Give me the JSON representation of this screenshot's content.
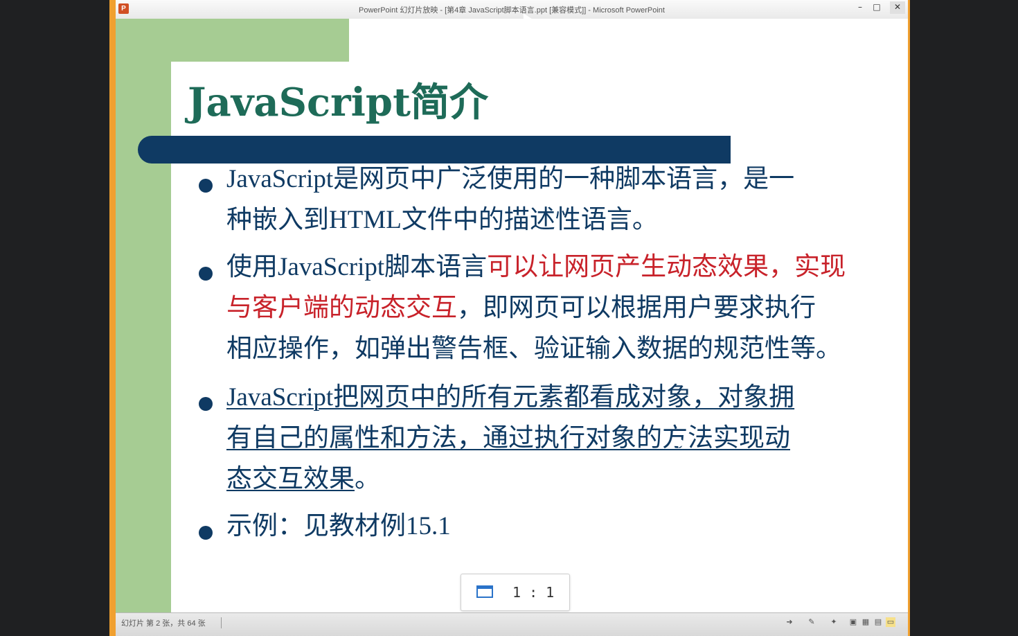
{
  "window": {
    "title": "PowerPoint 幻灯片放映 - [第4章 JavaScript脚本语言.ppt [兼容模式]] - Microsoft PowerPoint",
    "app_icon_letter": "P",
    "minimize": "–",
    "maximize": "□",
    "close": "✕"
  },
  "slide": {
    "title": "JavaScript简介",
    "bullets": [
      {
        "lines": [
          [
            {
              "text": "JavaScript是网页中广泛使用的一种脚本语言，是一",
              "style": "normal"
            }
          ],
          [
            {
              "text": "种嵌入到HTML文件中的描述性语言。",
              "style": "normal"
            }
          ]
        ]
      },
      {
        "lines": [
          [
            {
              "text": "使用JavaScript脚本语言",
              "style": "normal"
            },
            {
              "text": "可以让网页产生动态效果，实现",
              "style": "red"
            }
          ],
          [
            {
              "text": "与客户端的动态交互",
              "style": "red"
            },
            {
              "text": "，即网页可以根据用户要求执行",
              "style": "normal"
            }
          ],
          [
            {
              "text": "相应操作，如弹出警告框、验证输入数据的规范性等。",
              "style": "normal"
            }
          ]
        ]
      },
      {
        "lines": [
          [
            {
              "text": "JavaScript把网页中的所有元素都看成对象，对象拥",
              "style": "underline"
            }
          ],
          [
            {
              "text": "有自己的属性和方法，通过执行对象的方法实现动",
              "style": "underline"
            }
          ],
          [
            {
              "text": "态交互效果",
              "style": "underline"
            },
            {
              "text": "。",
              "style": "normal"
            }
          ]
        ]
      },
      {
        "lines": [
          [
            {
              "text": "示例：见教材例15.1",
              "style": "normal"
            }
          ]
        ]
      }
    ]
  },
  "zoom": {
    "label": "1 : 1",
    "icon": "window-icon"
  },
  "statusbar": {
    "text": "幻灯片 第 2 张，共 64 张",
    "icons": [
      "arrow-icon",
      "notes-icon",
      "pin-icon",
      "normal-view-icon",
      "sorter-view-icon",
      "reading-view-icon",
      "slideshow-icon"
    ]
  },
  "colors": {
    "title": "#1e6b58",
    "body": "#0f3a63",
    "emphasis": "#c8222a",
    "green_band": "#a6cc93",
    "blue_bar": "#0f3a63"
  }
}
